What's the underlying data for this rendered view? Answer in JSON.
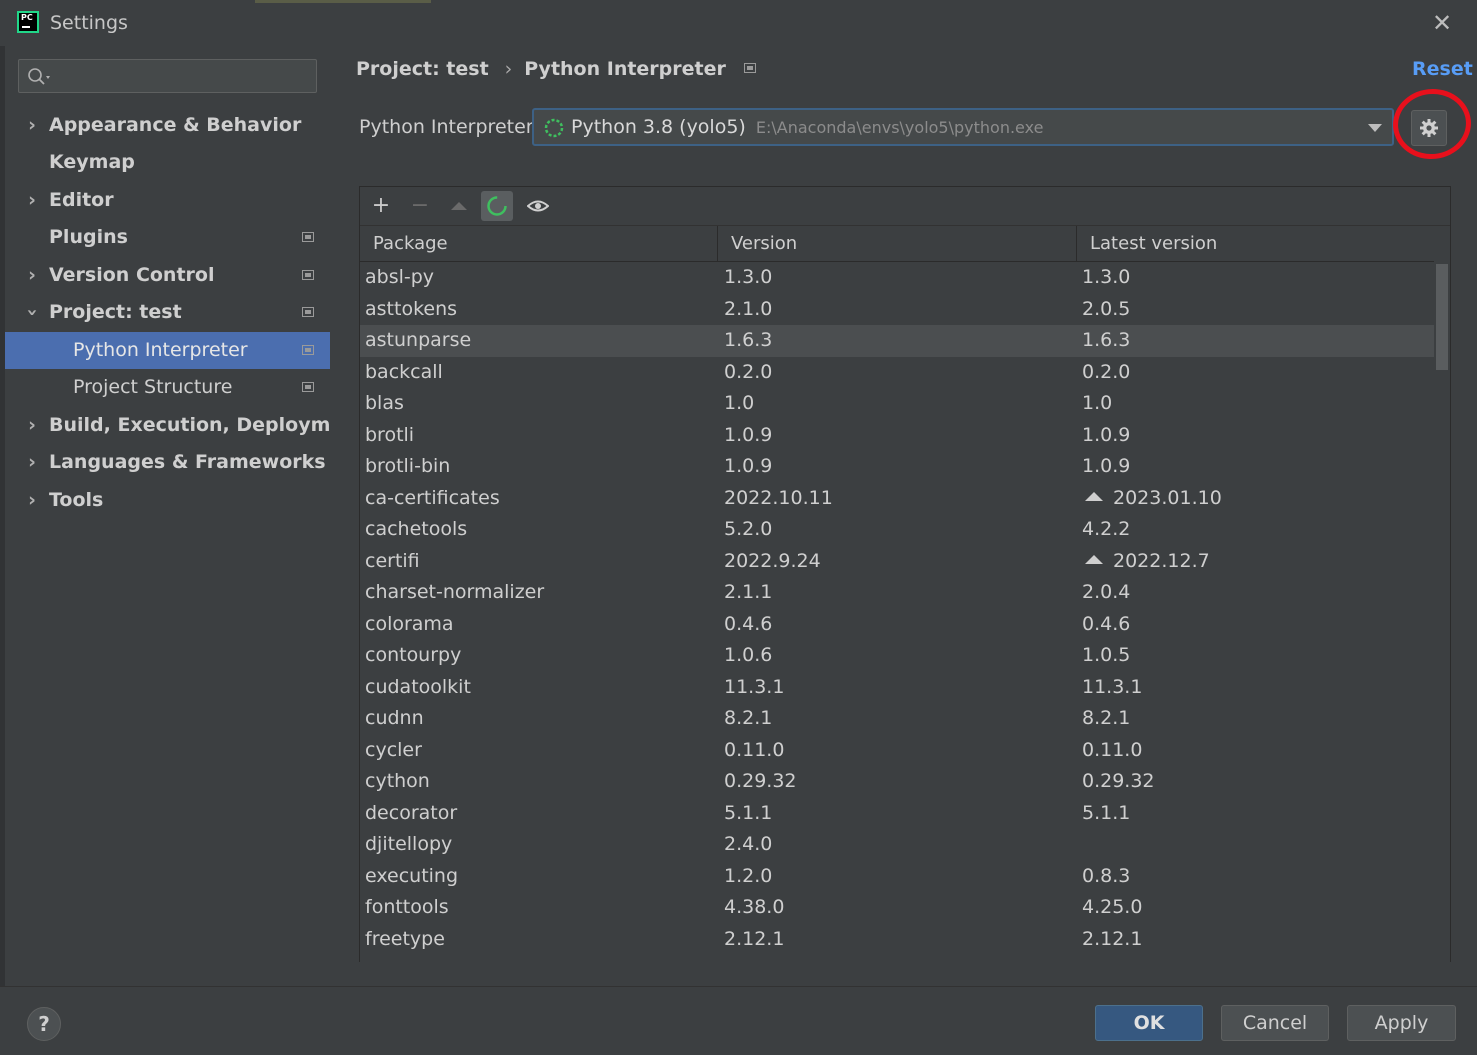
{
  "window": {
    "title": "Settings",
    "app_icon": "pycharm-icon",
    "close_icon": "close-icon"
  },
  "search": {
    "placeholder": "",
    "value": "",
    "icon": "search-icon"
  },
  "sidebar": {
    "items": [
      {
        "label": "Appearance & Behavior",
        "expandable": true,
        "expanded": false,
        "bold": true
      },
      {
        "label": "Keymap",
        "expandable": false,
        "bold": true
      },
      {
        "label": "Editor",
        "expandable": true,
        "expanded": false,
        "bold": true
      },
      {
        "label": "Plugins",
        "expandable": false,
        "bold": true,
        "project_icon": true
      },
      {
        "label": "Version Control",
        "expandable": true,
        "expanded": false,
        "bold": true,
        "project_icon": true
      },
      {
        "label": "Project: test",
        "expandable": true,
        "expanded": true,
        "bold": true,
        "project_icon": true
      },
      {
        "label": "Python Interpreter",
        "child": true,
        "selected": true,
        "project_icon": true
      },
      {
        "label": "Project Structure",
        "child": true,
        "project_icon": true
      },
      {
        "label": "Build, Execution, Deployment",
        "expandable": true,
        "expanded": false,
        "bold": true
      },
      {
        "label": "Languages & Frameworks",
        "expandable": true,
        "expanded": false,
        "bold": true
      },
      {
        "label": "Tools",
        "expandable": true,
        "expanded": false,
        "bold": true
      }
    ]
  },
  "breadcrumb": {
    "project": "Project: test",
    "separator": "›",
    "page": "Python Interpreter"
  },
  "reset_label": "Reset",
  "interpreter": {
    "label": "Python Interpreter:",
    "name": "Python 3.8 (yolo5)",
    "path": "E:\\Anaconda\\envs\\yolo5\\python.exe",
    "settings_icon": "gear-icon"
  },
  "toolbar": {
    "add": "+",
    "remove": "−",
    "upgrade_icon": "triangle-up-icon",
    "refresh_icon": "refresh-spinner-icon",
    "show_icon": "eye-icon"
  },
  "packages": {
    "columns": [
      "Package",
      "Version",
      "Latest version"
    ],
    "rows": [
      {
        "package": "absl-py",
        "version": "1.3.0",
        "latest": "1.3.0",
        "upgrade": false
      },
      {
        "package": "asttokens",
        "version": "2.1.0",
        "latest": "2.0.5",
        "upgrade": false
      },
      {
        "package": "astunparse",
        "version": "1.6.3",
        "latest": "1.6.3",
        "upgrade": false,
        "highlighted": true
      },
      {
        "package": "backcall",
        "version": "0.2.0",
        "latest": "0.2.0",
        "upgrade": false
      },
      {
        "package": "blas",
        "version": "1.0",
        "latest": "1.0",
        "upgrade": false
      },
      {
        "package": "brotli",
        "version": "1.0.9",
        "latest": "1.0.9",
        "upgrade": false
      },
      {
        "package": "brotli-bin",
        "version": "1.0.9",
        "latest": "1.0.9",
        "upgrade": false
      },
      {
        "package": "ca-certificates",
        "version": "2022.10.11",
        "latest": "2023.01.10",
        "upgrade": true
      },
      {
        "package": "cachetools",
        "version": "5.2.0",
        "latest": "4.2.2",
        "upgrade": false
      },
      {
        "package": "certifi",
        "version": "2022.9.24",
        "latest": "2022.12.7",
        "upgrade": true
      },
      {
        "package": "charset-normalizer",
        "version": "2.1.1",
        "latest": "2.0.4",
        "upgrade": false
      },
      {
        "package": "colorama",
        "version": "0.4.6",
        "latest": "0.4.6",
        "upgrade": false
      },
      {
        "package": "contourpy",
        "version": "1.0.6",
        "latest": "1.0.5",
        "upgrade": false
      },
      {
        "package": "cudatoolkit",
        "version": "11.3.1",
        "latest": "11.3.1",
        "upgrade": false
      },
      {
        "package": "cudnn",
        "version": "8.2.1",
        "latest": "8.2.1",
        "upgrade": false
      },
      {
        "package": "cycler",
        "version": "0.11.0",
        "latest": "0.11.0",
        "upgrade": false
      },
      {
        "package": "cython",
        "version": "0.29.32",
        "latest": "0.29.32",
        "upgrade": false
      },
      {
        "package": "decorator",
        "version": "5.1.1",
        "latest": "5.1.1",
        "upgrade": false
      },
      {
        "package": "djitellopy",
        "version": "2.4.0",
        "latest": "",
        "upgrade": false
      },
      {
        "package": "executing",
        "version": "1.2.0",
        "latest": "0.8.3",
        "upgrade": false
      },
      {
        "package": "fonttools",
        "version": "4.38.0",
        "latest": "4.25.0",
        "upgrade": false
      },
      {
        "package": "freetype",
        "version": "2.12.1",
        "latest": "2.12.1",
        "upgrade": false
      }
    ]
  },
  "footer": {
    "help": "?",
    "ok": "OK",
    "cancel": "Cancel",
    "apply": "Apply"
  },
  "colors": {
    "accent": "#4b6eaf",
    "link": "#589df6",
    "annotation": "#e8101c",
    "spinner": "#3fbf5f"
  }
}
